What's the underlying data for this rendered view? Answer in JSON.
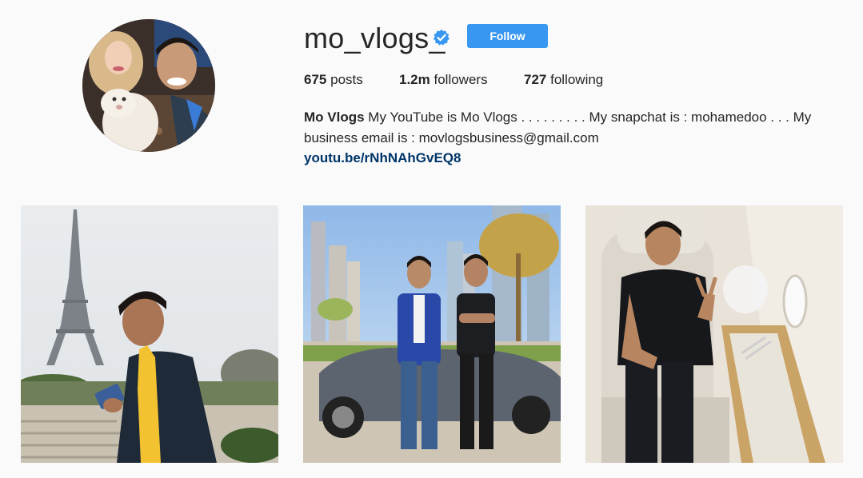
{
  "profile": {
    "username": "mo_vlogs_",
    "verified": true,
    "follow_label": "Follow",
    "accent_color": "#3897f0",
    "link_color": "#003569"
  },
  "stats": {
    "posts_count": "675",
    "posts_label": "posts",
    "followers_count": "1.2m",
    "followers_label": "followers",
    "following_count": "727",
    "following_label": "following"
  },
  "bio": {
    "name": "Mo Vlogs",
    "text": "My YouTube is Mo Vlogs . . . . . . . . . My snapchat is : mohamedoo . . . My business email is : movlogsbusiness@gmail.com",
    "link": "youtu.be/rNhNAhGvEQ8"
  },
  "icons": {
    "verified": "verified-badge-icon"
  }
}
